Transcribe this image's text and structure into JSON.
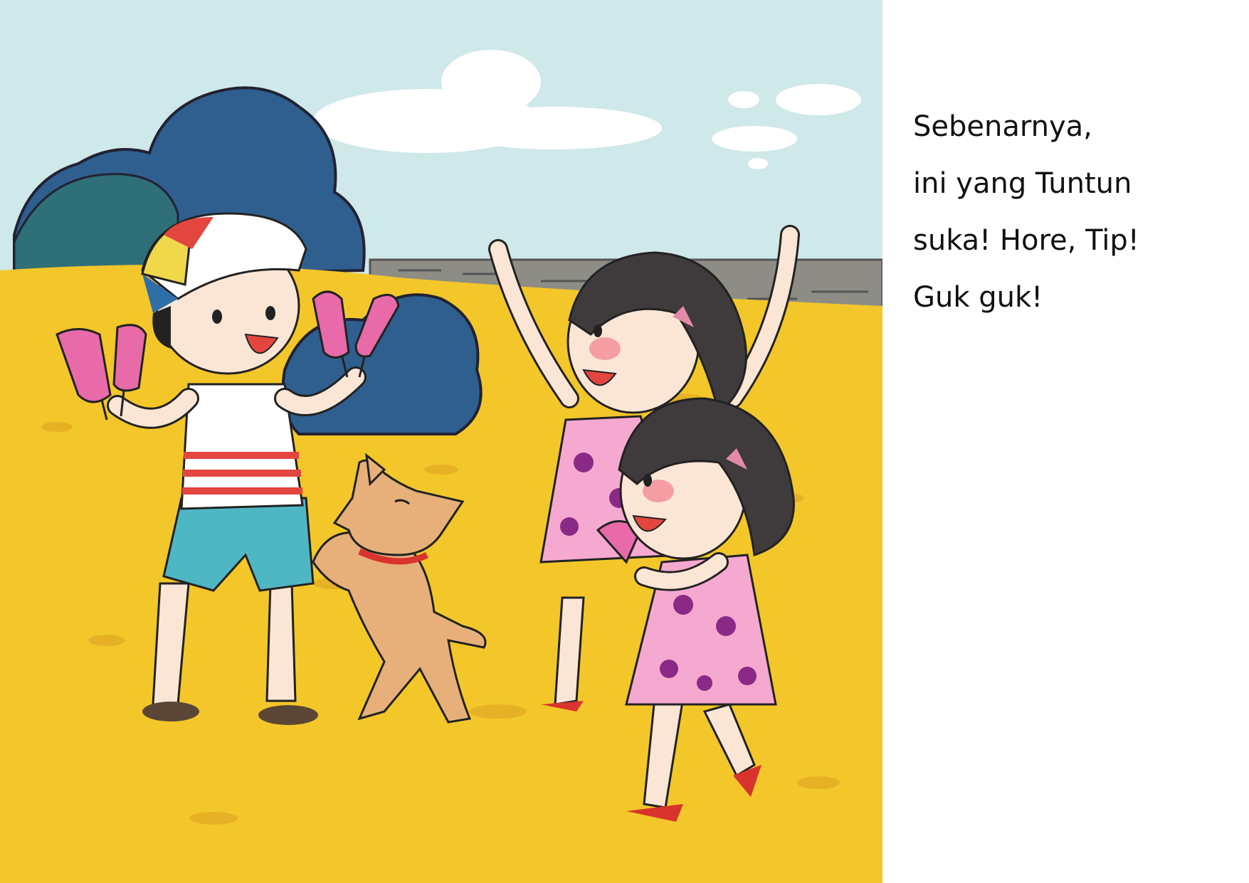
{
  "story": {
    "lines": [
      "Sebenarnya,",
      "ini yang Tuntun",
      "suka! Hore, Tip!",
      "Guk guk!"
    ]
  },
  "illustration": {
    "scene": "beach-play-scene",
    "colors": {
      "sky": "#cfe8ea",
      "sand": "#f3c72a",
      "sea": "#39b3b0",
      "bush": "#2f5f8f",
      "popsicle": "#e86aa8",
      "dress": "#f6a9d0",
      "dog": "#e7b07a"
    }
  }
}
